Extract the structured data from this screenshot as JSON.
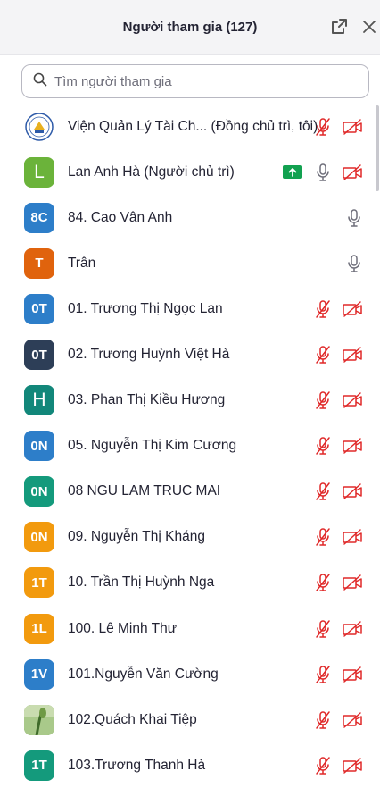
{
  "panel": {
    "title": "Người tham gia (127)",
    "search_placeholder": "Tìm người tham gia"
  },
  "participants": [
    {
      "name": "Viện Quản Lý Tài Ch...  (Đồng chủ trì, tôi)",
      "avatar": "",
      "avatar_type": "logo",
      "color": "#ffffff",
      "audio": "muted",
      "video": "off",
      "sharing": false
    },
    {
      "name": "Lan Anh Hà (Người chủ trì)",
      "avatar": "L",
      "avatar_type": "letter",
      "color": "#6bb33a",
      "audio": "on",
      "video": "off",
      "sharing": true
    },
    {
      "name": "84. Cao Vân Anh",
      "avatar": "8C",
      "avatar_type": "initials",
      "color": "#2d7ec9",
      "audio": "on",
      "video": "none",
      "sharing": false
    },
    {
      "name": "Trân",
      "avatar": "T",
      "avatar_type": "initials",
      "color": "#e0630d",
      "audio": "on",
      "video": "none",
      "sharing": false
    },
    {
      "name": "01. Trương Thị Ngọc Lan",
      "avatar": "0T",
      "avatar_type": "initials",
      "color": "#2d7ec9",
      "audio": "muted",
      "video": "off",
      "sharing": false
    },
    {
      "name": "02. Trương Huỳnh Việt Hà",
      "avatar": "0T",
      "avatar_type": "initials",
      "color": "#2d3e57",
      "audio": "muted",
      "video": "off",
      "sharing": false
    },
    {
      "name": "03. Phan Thị Kiều Hương",
      "avatar": "H",
      "avatar_type": "letter",
      "color": "#12877a",
      "audio": "muted",
      "video": "off",
      "sharing": false
    },
    {
      "name": "05. Nguyễn Thị Kim Cương",
      "avatar": "0N",
      "avatar_type": "initials",
      "color": "#2d7ec9",
      "audio": "muted",
      "video": "off",
      "sharing": false
    },
    {
      "name": "08 NGU LAM TRUC MAI",
      "avatar": "0N",
      "avatar_type": "initials",
      "color": "#149a7c",
      "audio": "muted",
      "video": "off",
      "sharing": false
    },
    {
      "name": "09. Nguyễn Thị Kháng",
      "avatar": "0N",
      "avatar_type": "initials",
      "color": "#f29a0e",
      "audio": "muted",
      "video": "off",
      "sharing": false
    },
    {
      "name": "10. Trần Thị Huỳnh Nga",
      "avatar": "1T",
      "avatar_type": "initials",
      "color": "#f29a0e",
      "audio": "muted",
      "video": "off",
      "sharing": false
    },
    {
      "name": "100. Lê Minh Thư",
      "avatar": "1L",
      "avatar_type": "initials",
      "color": "#f29a0e",
      "audio": "muted",
      "video": "off",
      "sharing": false
    },
    {
      "name": "101.Nguyễn Văn Cường",
      "avatar": "1V",
      "avatar_type": "initials",
      "color": "#2d7ec9",
      "audio": "muted",
      "video": "off",
      "sharing": false
    },
    {
      "name": "102.Quách Khai Tiệp",
      "avatar": "",
      "avatar_type": "photo",
      "color": "#5c8a3a",
      "audio": "muted",
      "video": "off",
      "sharing": false
    },
    {
      "name": "103.Trương Thanh Hà",
      "avatar": "1T",
      "avatar_type": "initials",
      "color": "#149a7c",
      "audio": "muted",
      "video": "off",
      "sharing": false
    }
  ],
  "colors": {
    "muted_red": "#e02828",
    "mic_gray": "#6e6e7a",
    "share_green": "#12a150"
  }
}
